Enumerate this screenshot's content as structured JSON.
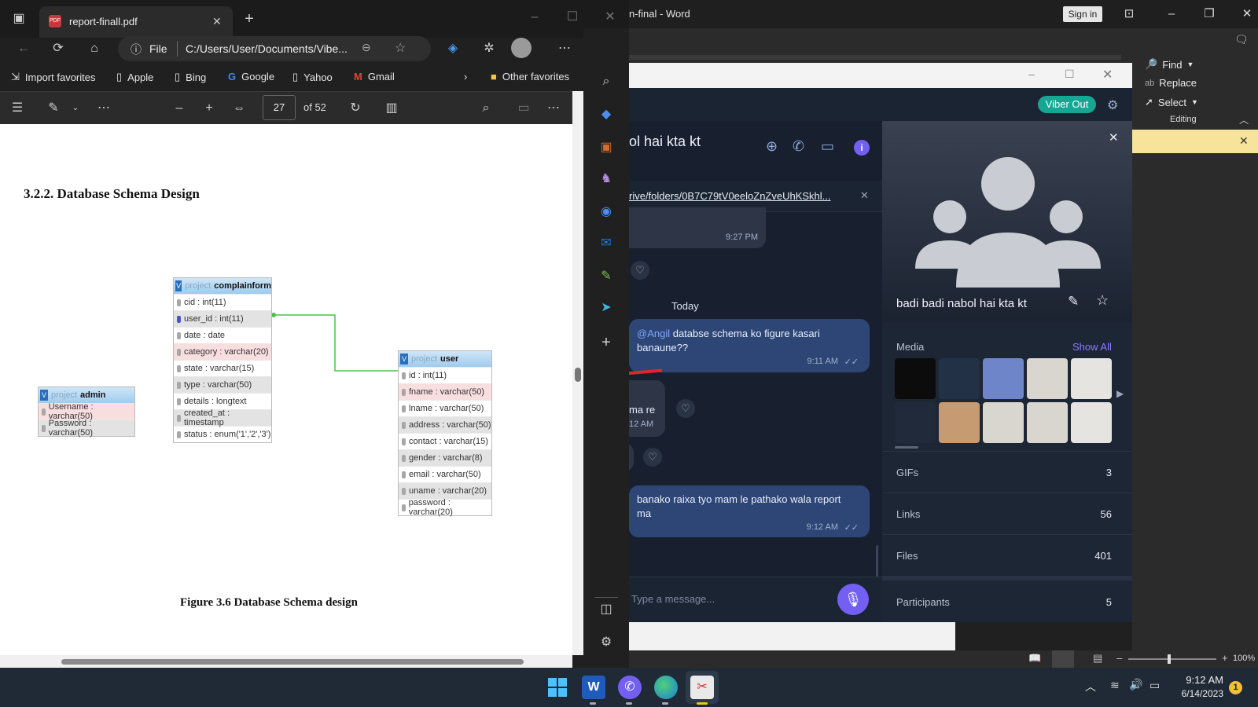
{
  "word": {
    "title": "n-final  -  Word",
    "sign_in": "Sign in",
    "find": "Find",
    "replace": "Replace",
    "select": "Select",
    "group_label": "Editing",
    "zoom": "100%"
  },
  "edge": {
    "tab_title": "report-finall.pdf",
    "address_label": "File",
    "address_url": "C:/Users/User/Documents/Vibe...",
    "favorites": [
      {
        "label": "Import favorites"
      },
      {
        "label": "Apple"
      },
      {
        "label": "Bing"
      },
      {
        "label": "Google"
      },
      {
        "label": "Yahoo"
      },
      {
        "label": "Gmail"
      }
    ],
    "other_favorites": "Other favorites",
    "page_number": "27",
    "page_total": "of 52"
  },
  "pdf": {
    "heading": "3.2.2. Database Schema Design",
    "caption": "Figure 3.6 Database Schema design",
    "tables": {
      "complainform": {
        "prefix": "project",
        "name": "complainform",
        "rows": [
          "cid : int(11)",
          "user_id : int(11)",
          "date : date",
          "category : varchar(20)",
          "state : varchar(15)",
          "type : varchar(50)",
          "details : longtext",
          "created_at : timestamp",
          "status : enum('1','2','3')"
        ]
      },
      "admin": {
        "prefix": "project",
        "name": "admin",
        "rows": [
          "Username : varchar(50)",
          "Password : varchar(50)"
        ]
      },
      "user": {
        "prefix": "project",
        "name": "user",
        "rows": [
          "id : int(11)",
          "fname : varchar(50)",
          "lname : varchar(50)",
          "address : varchar(50)",
          "contact : varchar(15)",
          "gender : varchar(8)",
          "email : varchar(50)",
          "uname : varchar(20)",
          "password : varchar(20)"
        ]
      }
    }
  },
  "viber": {
    "viber_out": "Viber Out",
    "chat_title": "ol hai kta kt",
    "pinned_link": "rive/folders/0B7C79tV0eeloZnZveUhKSkhl...",
    "messages": [
      {
        "time": "9:27 PM"
      },
      {
        "day": "Today"
      },
      {
        "mention": "@Angil",
        "text": " databse schema ko figure kasari banaune??",
        "time": "9:11 AM"
      },
      {
        "text": "ma re",
        "time": "12 AM"
      },
      {
        "text": "banako raixa tyo mam le pathako wala report ma",
        "time": "9:12 AM"
      }
    ],
    "input_placeholder": "Type a message...",
    "group_name": "badi badi nabol hai kta kt",
    "media_label": "Media",
    "show_all": "Show All",
    "stats": [
      {
        "label": "GIFs",
        "value": "3"
      },
      {
        "label": "Links",
        "value": "56"
      },
      {
        "label": "Files",
        "value": "401"
      },
      {
        "label": "Participants",
        "value": "5"
      }
    ]
  },
  "taskbar": {
    "time": "9:12 AM",
    "date": "6/14/2023",
    "notification_count": "1"
  }
}
